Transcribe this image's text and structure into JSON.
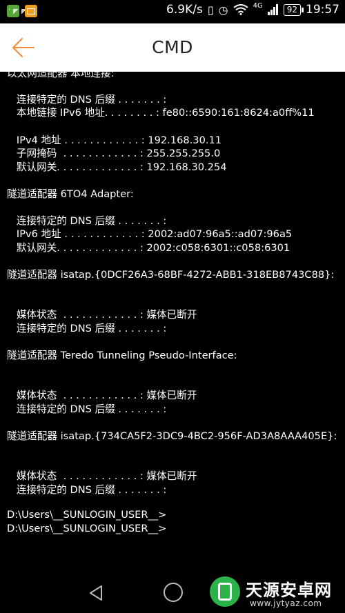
{
  "status_bar": {
    "speed": "6.9K/s",
    "network": "4G",
    "battery": "92",
    "time": "19:57"
  },
  "app_bar": {
    "title": "CMD"
  },
  "terminal": {
    "lines": [
      "以太网适配器 本地连接:",
      "   连接特定的 DNS 后缀 . . . . . . . :",
      "   本地链接 IPv6 地址. . . . . . . . : fe80::6590:161:8624:a0ff%11",
      "   IPv4 地址 . . . . . . . . . . . . : 192.168.30.11",
      "   子网掩码  . . . . . . . . . . . . : 255.255.255.0",
      "   默认网关. . . . . . . . . . . . . : 192.168.30.254",
      "隧道适配器 6TO4 Adapter:",
      "   连接特定的 DNS 后缀 . . . . . . . :",
      "   IPv6 地址 . . . . . . . . . . . . : 2002:ad07:96a5::ad07:96a5",
      "   默认网关. . . . . . . . . . . . . : 2002:c058:6301::c058:6301",
      "隧道适配器 isatap.{0DCF26A3-68BF-4272-ABB1-318EB8743C88}:",
      "   媒体状态  . . . . . . . . . . . . : 媒体已断开",
      "   连接特定的 DNS 后缀 . . . . . . . :",
      "隧道适配器 Teredo Tunneling Pseudo-Interface:",
      "   媒体状态  . . . . . . . . . . . . : 媒体已断开",
      "   连接特定的 DNS 后缀 . . . . . . . :",
      "隧道适配器 isatap.{734CA5F2-3DC9-4BC2-956F-AD3A8AAA405E}:",
      "   媒体状态  . . . . . . . . . . . . : 媒体已断开",
      "   连接特定的 DNS 后缀 . . . . . . . :",
      "D:\\Users\\__SUNLOGIN_USER__>",
      "D:\\Users\\__SUNLOGIN_USER__>"
    ]
  },
  "watermark": {
    "name": "天源安卓网",
    "url": "www.jytyaz.com"
  },
  "icons": {
    "back": "arrow-left-icon",
    "nav_back": "triangle-back-icon",
    "nav_home": "circle-home-icon"
  },
  "colors": {
    "accent": "#f08a3c",
    "terminal_bg": "#000000",
    "terminal_fg": "#ffffff"
  }
}
